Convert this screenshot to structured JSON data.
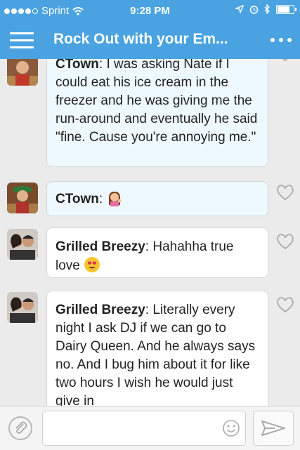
{
  "status_bar": {
    "carrier": "Sprint",
    "time": "9:28 PM",
    "battery_level": 0.85
  },
  "header": {
    "title": "Rock Out with your Em..."
  },
  "messages": [
    {
      "author": "CTown",
      "separator": ":",
      "text": " I was asking Nate if I could eat his ice cream in the freezer and he was giving me the run-around and eventually he said \"fine. Cause you're annoying me.\"",
      "emoji": "",
      "own": true
    },
    {
      "author": "CTown",
      "separator": ":",
      "text": " ",
      "emoji": "woman-tipping-hand",
      "own": true
    },
    {
      "author": "Grilled Breezy",
      "separator": ":",
      "text": " Hahahha true love ",
      "emoji": "heart-eyes",
      "own": false
    },
    {
      "author": "Grilled Breezy",
      "separator": ":",
      "text": " Literally every night I ask DJ if we can go to Dairy Queen. And he always says no. And I bug him about it for like two hours I wish he would just give in",
      "emoji": "",
      "own": false
    }
  ],
  "composer": {
    "placeholder": ""
  },
  "colors": {
    "header": "#4aa3e0",
    "own_bubble": "#eef9ff",
    "other_bubble": "#ffffff",
    "background": "#ebebeb"
  },
  "icons": [
    "signal-icon",
    "wifi-icon",
    "location-icon",
    "alarm-icon",
    "bluetooth-icon",
    "battery-icon",
    "menu-icon",
    "more-icon",
    "heart-icon",
    "attach-icon",
    "smiley-icon",
    "send-icon"
  ]
}
